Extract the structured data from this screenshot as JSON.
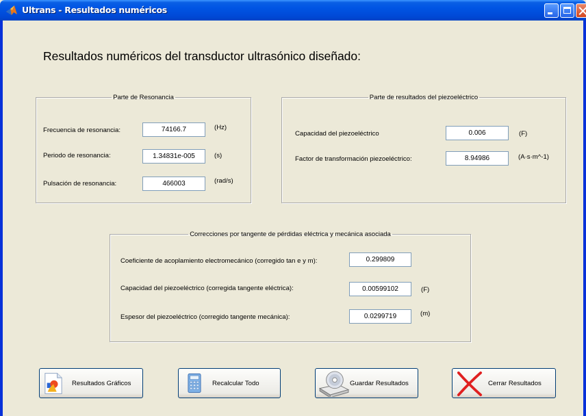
{
  "window": {
    "title": "Ultrans - Resultados numéricos"
  },
  "heading": "Resultados numéricos del transductor ultrasónico diseñado:",
  "resonance": {
    "legend": "Parte de Resonancia",
    "rows": [
      {
        "label": "Frecuencia de resonancia:",
        "value": "74166.7",
        "unit": "(Hz)"
      },
      {
        "label": "Periodo de resonancia:",
        "value": "1.34831e-005",
        "unit": "(s)"
      },
      {
        "label": "Pulsación de resonancia:",
        "value": "466003",
        "unit": "(rad/s)"
      }
    ]
  },
  "piezo": {
    "legend": "Parte de resultados del piezoeléctrico",
    "rows": [
      {
        "label": "Capacidad del piezoeléctrico",
        "value": "0.006",
        "unit": "(F)"
      },
      {
        "label": "Factor de transformación piezoeléctrico:",
        "value": "8.94986",
        "unit": "(A·s·m^-1)"
      }
    ]
  },
  "corrections": {
    "legend": "Correcciones por tangente de pérdidas eléctrica y mecánica asociada",
    "rows": [
      {
        "label": "Coeficiente de acoplamiento electromecánico (corregido tan e y m):",
        "value": "0.299809",
        "unit": ""
      },
      {
        "label": "Capacidad del piezoeléctrico (corregida tangente eléctrica):",
        "value": "0.00599102",
        "unit": "(F)"
      },
      {
        "label": "Espesor del piezoeléctrico (corregido tangente mecánica):",
        "value": "0.0299719",
        "unit": "(m)"
      }
    ]
  },
  "buttons": {
    "graphs": "Resultados Gráficos",
    "recalc": "Recalcular Todo",
    "save": "Guardar Resultados",
    "close": "Cerrar Resultados"
  }
}
